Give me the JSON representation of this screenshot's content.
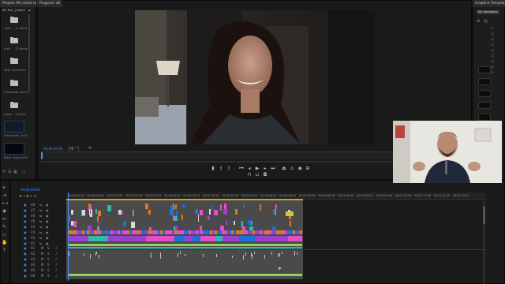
{
  "project_panel": {
    "tab_label": "Project: file name (depart)",
    "breadcrumb": "file fino _project",
    "bins": [
      {
        "name": "Opto...",
        "count": "11 items"
      },
      {
        "name": "Stall",
        "count": "13 items"
      },
      {
        "name": "after di...",
        "count": "4 items"
      },
      {
        "name": "screens...",
        "count": "44 items"
      },
      {
        "name": "Logos",
        "count": "3 items"
      },
      {
        "name": "Adjustmen...",
        "count": "0;00"
      },
      {
        "name": "Black Video",
        "count": "0;00"
      }
    ]
  },
  "program_monitor": {
    "tab_label": "Program: v3",
    "timecode": "00;00;00;00",
    "fit_label": "Fit",
    "transport_icons": [
      "mark-in-icon",
      "mark-out-icon",
      "go-to-in-icon",
      "step-back-icon",
      "play-icon",
      "step-forward-icon",
      "go-to-out-icon",
      "insert-icon",
      "overwrite-icon",
      "export-frame-icon"
    ]
  },
  "graphics_panel": {
    "tab_label": "Graphics Templat",
    "my_templates_label": "My Templates"
  },
  "timeline": {
    "timecode": "00;00;00;00",
    "ruler_labels": [
      "00;00;04;02",
      "00;00;08;04",
      "00;00;12;06",
      "00;00;16;08",
      "00;00;20;10",
      "00;00;24;12",
      "00;00;28;14",
      "00;00;32;16",
      "00;00;36;18",
      "00;00;40;20",
      "00;00;44;22",
      "00;00;48;24",
      "00;00;52;26",
      "00;00;56;28",
      "00;01;01;00",
      "00;01;05;02",
      "00;01;09;04",
      "00;01;13;06",
      "00;01;17;08",
      "00;01;21;10",
      "00;01;25;12"
    ],
    "video_tracks": [
      "V8",
      "V7",
      "V6",
      "V5",
      "V4",
      "V3",
      "V2",
      "V1"
    ],
    "audio_tracks": [
      "A1",
      "A2",
      "A3",
      "A4",
      "A5",
      "A6"
    ],
    "colors": {
      "purple": "#9b3fd1",
      "blue": "#1f6fd8",
      "pink": "#e84cc8",
      "orange": "#d77a2a",
      "green": "#8bd55d",
      "teal": "#2fb9a8",
      "playhead": "#4a8cff",
      "yellow": "#c8c83a"
    }
  }
}
